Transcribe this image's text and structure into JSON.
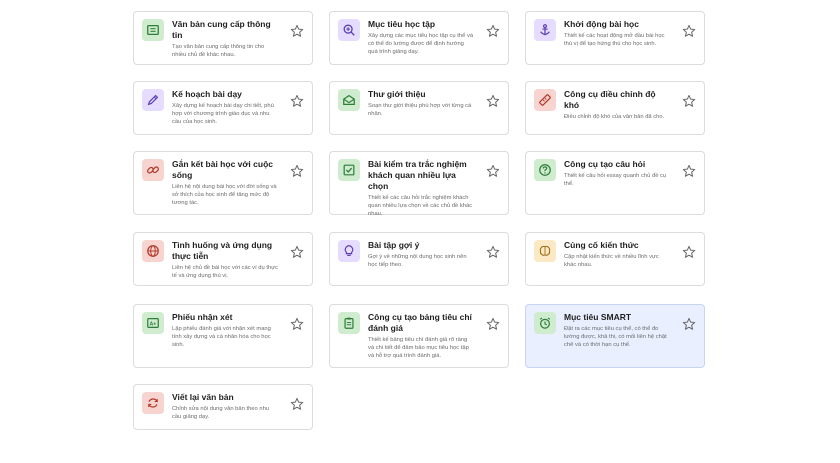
{
  "cards": [
    {
      "title": "Văn bản cung cấp thông tin",
      "desc": "Tạo văn bản cung cấp thông tin cho nhiều chủ đề khác nhau.",
      "icon": "document-text-icon",
      "icon_bg": "#cfeccf",
      "icon_color": "#2f7d3a"
    },
    {
      "title": "Mục tiêu học tập",
      "desc": "Xây dựng các mục tiêu học tập cụ thể và có thể đo lường được để định hướng quá trình giảng dạy.",
      "icon": "magnifier-plus-icon",
      "icon_bg": "#e6dcff",
      "icon_color": "#5b3fb0"
    },
    {
      "title": "Khởi động bài học",
      "desc": "Thiết kế các hoạt động mở đầu bài học thú vị để tạo hứng thú cho học sinh.",
      "icon": "anchor-icon",
      "icon_bg": "#e6dcff",
      "icon_color": "#5b3fb0"
    },
    {
      "title": "Kế hoạch bài dạy",
      "desc": "Xây dựng kế hoạch bài dạy chi tiết, phù hợp với chương trình giáo dục và nhu cầu của học sinh.",
      "icon": "pencil-icon",
      "icon_bg": "#e6dcff",
      "icon_color": "#5b3fb0"
    },
    {
      "title": "Thư giới thiệu",
      "desc": "Soạn thư giới thiệu phù hợp với từng cá nhân.",
      "icon": "mail-open-icon",
      "icon_bg": "#cfeccf",
      "icon_color": "#2f7d3a"
    },
    {
      "title": "Công cụ điều chỉnh độ khó",
      "desc": "Điều chỉnh độ khó của văn bản đã cho.",
      "icon": "ruler-icon",
      "icon_bg": "#f7d4cf",
      "icon_color": "#b3392b"
    },
    {
      "title": "Gắn kết bài học với cuộc sống",
      "desc": "Liên hệ nội dung bài học với đời sống và sở thích của học sinh để tăng mức độ tương tác.",
      "icon": "link-icon",
      "icon_bg": "#f7d4cf",
      "icon_color": "#b3392b"
    },
    {
      "title": "Bài kiểm tra trắc nghiệm khách quan nhiều lựa chọn",
      "desc": "Thiết kế các câu hỏi trắc nghiệm khách quan nhiều lựa chọn về các chủ đề khác nhau.",
      "icon": "checkbox-icon",
      "icon_bg": "#cfeccf",
      "icon_color": "#2f7d3a"
    },
    {
      "title": "Công cụ tạo câu hỏi",
      "desc": "Thiết kế câu hỏi essay quanh chủ đề cụ thể.",
      "icon": "question-circle-icon",
      "icon_bg": "#cfeccf",
      "icon_color": "#2f7d3a"
    },
    {
      "title": "Tình huống và ứng dụng thực tiễn",
      "desc": "Liên hệ chủ đề bài học với các ví dụ thực tế và ứng dụng thú vị.",
      "icon": "globe-icon",
      "icon_bg": "#f7d4cf",
      "icon_color": "#b3392b"
    },
    {
      "title": "Bài tập gợi ý",
      "desc": "Gợi ý về những nội dung học sinh nên học tiếp theo.",
      "icon": "lightbulb-icon",
      "icon_bg": "#e6dcff",
      "icon_color": "#5b3fb0"
    },
    {
      "title": "Củng cố kiến thức",
      "desc": "Cập nhật kiến thức về nhiều lĩnh vực khác nhau.",
      "icon": "brain-icon",
      "icon_bg": "#fbe9c5",
      "icon_color": "#a06a14"
    },
    {
      "title": "Phiếu nhận xét",
      "desc": "Lập phiếu đánh giá với nhận xét mang tính xây dựng và cá nhân hóa cho học sinh.",
      "icon": "grade-card-icon",
      "icon_bg": "#cfeccf",
      "icon_color": "#2f7d3a"
    },
    {
      "title": "Công cụ tạo bảng tiêu chí đánh giá",
      "desc": "Thiết kế bảng tiêu chí đánh giá rõ ràng và chi tiết để đảm bảo mục tiêu học tập và hỗ trợ quá trình đánh giá.",
      "icon": "clipboard-icon",
      "icon_bg": "#cfeccf",
      "icon_color": "#2f7d3a"
    },
    {
      "title": "Mục tiêu SMART",
      "desc": "Đặt ra các mục tiêu cụ thể, có thể đo lường được, khả thi, có mối liên hệ chặt chẽ và có thời hạn cụ thể.",
      "icon": "alarm-clock-icon",
      "icon_bg": "#cfeccf",
      "icon_color": "#2f7d3a",
      "selected": true
    },
    {
      "title": "Viết lại văn bản",
      "desc": "Chỉnh sửa nội dung văn bản theo nhu cầu giảng dạy.",
      "icon": "refresh-icon",
      "icon_bg": "#f7d4cf",
      "icon_color": "#b3392b"
    }
  ],
  "star_color": "#6a6a6a",
  "favorite_label": "star-icon"
}
